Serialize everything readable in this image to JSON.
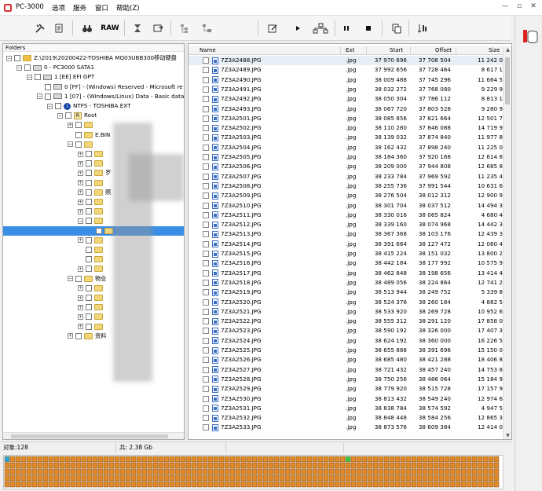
{
  "app": {
    "title": "PC-3000",
    "menu": [
      "选项",
      "服务",
      "窗口",
      "帮助(Z)"
    ],
    "window_buttons": [
      "—",
      "▫",
      "✕"
    ]
  },
  "toolbar": {
    "raw_label": "RAW",
    "icons": [
      "tools-icon",
      "scroll-icon",
      "binoculars-icon",
      "raw-button",
      "hourglass-icon",
      "export-icon",
      "tree-icon",
      "tree-alt-icon",
      "edit-icon",
      "play-icon",
      "network-icon",
      "pause-icon",
      "stop-icon",
      "copy-icon",
      "sort-icon"
    ]
  },
  "tree": {
    "title": "Folders",
    "items": [
      {
        "label": "Z:\\2019\\20200422-TOSHIBA MQ03UBB300移动硬盘",
        "icon": "drive",
        "depth": 0,
        "expander": "-"
      },
      {
        "label": "0 - PC3000 SATA1",
        "icon": "hdd",
        "depth": 1,
        "expander": "-"
      },
      {
        "label": "1 [EE] EFI GPT",
        "icon": "hdd",
        "depth": 2,
        "expander": "-"
      },
      {
        "label": "0 [FF] - (Windows) Reserved - Microsoft re",
        "icon": "hdd",
        "depth": 3,
        "expander": ""
      },
      {
        "label": "1 [07] - (Windows/Linux) Data - Basic data",
        "icon": "hdd",
        "depth": 3,
        "expander": "-"
      },
      {
        "label": "NTFS - TOSHIBA EXT",
        "icon": "info",
        "depth": 4,
        "expander": "-"
      },
      {
        "label": "Root",
        "icon": "root",
        "depth": 5,
        "expander": "-"
      },
      {
        "label": "",
        "icon": "folder",
        "depth": 6,
        "expander": "+"
      },
      {
        "label": "E.BIN",
        "icon": "folder",
        "depth": 6,
        "expander": ""
      },
      {
        "label": "",
        "icon": "folder",
        "depth": 6,
        "expander": "-"
      },
      {
        "label": "",
        "icon": "folder",
        "depth": 7,
        "expander": "+"
      },
      {
        "label": "",
        "icon": "folder",
        "depth": 7,
        "expander": "+"
      },
      {
        "label": "岁",
        "icon": "folder",
        "depth": 7,
        "expander": "+"
      },
      {
        "label": "",
        "icon": "folder",
        "depth": 7,
        "expander": "+"
      },
      {
        "label": "照",
        "icon": "folder",
        "depth": 7,
        "expander": "+"
      },
      {
        "label": "",
        "icon": "folder",
        "depth": 7,
        "expander": "+"
      },
      {
        "label": "",
        "icon": "folder",
        "depth": 7,
        "expander": "+"
      },
      {
        "label": "",
        "icon": "folder",
        "depth": 7,
        "expander": "-"
      },
      {
        "label": "",
        "icon": "folder",
        "depth": 8,
        "expander": ""
      },
      {
        "label": "",
        "icon": "folder",
        "depth": 7,
        "expander": "+"
      },
      {
        "label": "",
        "icon": "folder",
        "depth": 7,
        "expander": ""
      },
      {
        "label": "",
        "icon": "folder",
        "depth": 7,
        "expander": ""
      },
      {
        "label": "",
        "icon": "folder",
        "depth": 7,
        "expander": "+"
      },
      {
        "label": "物业",
        "icon": "folder",
        "depth": 6,
        "expander": "-"
      },
      {
        "label": "",
        "icon": "folder",
        "depth": 7,
        "expander": "+"
      },
      {
        "label": "",
        "icon": "folder",
        "depth": 7,
        "expander": "+"
      },
      {
        "label": "",
        "icon": "folder",
        "depth": 7,
        "expander": "+"
      },
      {
        "label": "",
        "icon": "folder",
        "depth": 7,
        "expander": "+"
      },
      {
        "label": "",
        "icon": "folder",
        "depth": 7,
        "expander": "+"
      },
      {
        "label": "资料",
        "icon": "folder",
        "depth": 6,
        "expander": "+"
      }
    ],
    "selected_index": 18
  },
  "list": {
    "columns": [
      "Name",
      "Ext",
      "Start",
      "Offset",
      "Size"
    ],
    "rows": [
      [
        "7Z3A2488.JPG",
        ".jpg",
        "37 970 696",
        "37 706 504",
        "11 242 0"
      ],
      [
        "7Z3A2489.JPG",
        ".jpg",
        "37 992 656",
        "37 728 464",
        "8 617 1"
      ],
      [
        "7Z3A2490.JPG",
        ".jpg",
        "38 009 488",
        "37 745 296",
        "11 664 5"
      ],
      [
        "7Z3A2491.JPG",
        ".jpg",
        "38 032 272",
        "37 768 080",
        "9 229 9"
      ],
      [
        "7Z3A2492.JPG",
        ".jpg",
        "38 050 304",
        "37 786 112",
        "8 813 1"
      ],
      [
        "7Z3A2493.JPG",
        ".jpg",
        "38 067 720",
        "37 803 528",
        "9 280 9"
      ],
      [
        "7Z3A2501.JPG",
        ".jpg",
        "38 085 856",
        "37 821 664",
        "12 501 7"
      ],
      [
        "7Z3A2502.JPG",
        ".jpg",
        "38 110 280",
        "37 846 088",
        "14 719 9"
      ],
      [
        "7Z3A2503.JPG",
        ".jpg",
        "38 139 032",
        "37 874 840",
        "11 977 8"
      ],
      [
        "7Z3A2504.JPG",
        ".jpg",
        "38 162 432",
        "37 898 240",
        "11 225 0"
      ],
      [
        "7Z3A2505.JPG",
        ".jpg",
        "38 184 360",
        "37 920 168",
        "12 614 8"
      ],
      [
        "7Z3A2506.JPG",
        ".jpg",
        "38 209 000",
        "37 944 808",
        "12 685 8"
      ],
      [
        "7Z3A2507.JPG",
        ".jpg",
        "38 233 784",
        "37 969 592",
        "11 235 4"
      ],
      [
        "7Z3A2508.JPG",
        ".jpg",
        "38 255 736",
        "37 991 544",
        "10 631 6"
      ],
      [
        "7Z3A2509.JPG",
        ".jpg",
        "38 276 504",
        "38 012 312",
        "12 900 9"
      ],
      [
        "7Z3A2510.JPG",
        ".jpg",
        "38 301 704",
        "38 037 512",
        "14 494 3"
      ],
      [
        "7Z3A2511.JPG",
        ".jpg",
        "38 330 016",
        "38 065 824",
        "4 680 4"
      ],
      [
        "7Z3A2512.JPG",
        ".jpg",
        "38 339 160",
        "38 074 968",
        "14 442 3"
      ],
      [
        "7Z3A2513.JPG",
        ".jpg",
        "38 367 368",
        "38 103 176",
        "12 439 3"
      ],
      [
        "7Z3A2514.JPG",
        ".jpg",
        "38 391 664",
        "38 127 472",
        "12 060 4"
      ],
      [
        "7Z3A2515.JPG",
        ".jpg",
        "38 415 224",
        "38 151 032",
        "13 800 2"
      ],
      [
        "7Z3A2516.JPG",
        ".jpg",
        "38 442 184",
        "38 177 992",
        "10 575 9"
      ],
      [
        "7Z3A2517.JPG",
        ".jpg",
        "38 462 848",
        "38 198 656",
        "13 414 4"
      ],
      [
        "7Z3A2518.JPG",
        ".jpg",
        "38 489 056",
        "38 224 864",
        "12 741 2"
      ],
      [
        "7Z3A2519.JPG",
        ".jpg",
        "38 513 944",
        "38 249 752",
        "5 339 8"
      ],
      [
        "7Z3A2520.JPG",
        ".jpg",
        "38 524 376",
        "38 260 184",
        "4 882 5"
      ],
      [
        "7Z3A2521.JPG",
        ".jpg",
        "38 533 920",
        "38 269 728",
        "10 952 6"
      ],
      [
        "7Z3A2522.JPG",
        ".jpg",
        "38 555 312",
        "38 291 120",
        "17 858 0"
      ],
      [
        "7Z3A2523.JPG",
        ".jpg",
        "38 590 192",
        "38 326 000",
        "17 407 3"
      ],
      [
        "7Z3A2524.JPG",
        ".jpg",
        "38 624 192",
        "38 360 000",
        "16 226 5"
      ],
      [
        "7Z3A2525.JPG",
        ".jpg",
        "38 655 888",
        "38 391 696",
        "15 150 0"
      ],
      [
        "7Z3A2526.JPG",
        ".jpg",
        "38 685 480",
        "38 421 288",
        "18 406 8"
      ],
      [
        "7Z3A2527.JPG",
        ".jpg",
        "38 721 432",
        "38 457 240",
        "14 753 8"
      ],
      [
        "7Z3A2528.JPG",
        ".jpg",
        "38 750 256",
        "38 486 064",
        "15 184 9"
      ],
      [
        "7Z3A2529.JPG",
        ".jpg",
        "38 779 920",
        "38 515 728",
        "17 157 9"
      ],
      [
        "7Z3A2530.JPG",
        ".jpg",
        "38 813 432",
        "38 549 240",
        "12 974 6"
      ],
      [
        "7Z3A2531.JPG",
        ".jpg",
        "38 838 784",
        "38 574 592",
        "4 947 5"
      ],
      [
        "7Z3A2532.JPG",
        ".jpg",
        "38 848 448",
        "38 584 256",
        "12 865 3"
      ],
      [
        "7Z3A2533.JPG",
        ".jpg",
        "38 873 576",
        "38 609 384",
        "12 414 0"
      ]
    ]
  },
  "status": {
    "objects": "对象:128",
    "total": "共: 2.38 Gb"
  },
  "sector_map": {
    "fill_color": "#e08a2a",
    "highlight_color": "#3cc94a",
    "first_color": "#2aa5d8"
  }
}
